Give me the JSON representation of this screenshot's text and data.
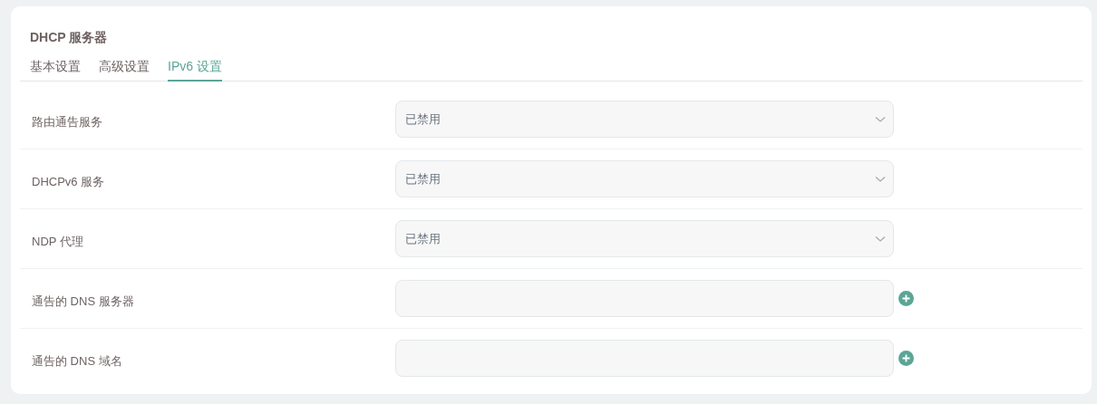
{
  "panel": {
    "title": "DHCP 服务器"
  },
  "tabs": [
    {
      "label": "基本设置",
      "selected": false
    },
    {
      "label": "高级设置",
      "selected": false
    },
    {
      "label": "IPv6 设置",
      "selected": true
    }
  ],
  "rows": [
    {
      "label": "路由通告服务",
      "kind": "select",
      "value": "已禁用"
    },
    {
      "label": "DHCPv6 服务",
      "kind": "select",
      "value": "已禁用"
    },
    {
      "label": "NDP 代理",
      "kind": "select",
      "value": "已禁用"
    },
    {
      "label": "通告的 DNS 服务器",
      "kind": "list"
    },
    {
      "label": "通告的 DNS 域名",
      "kind": "list"
    }
  ]
}
